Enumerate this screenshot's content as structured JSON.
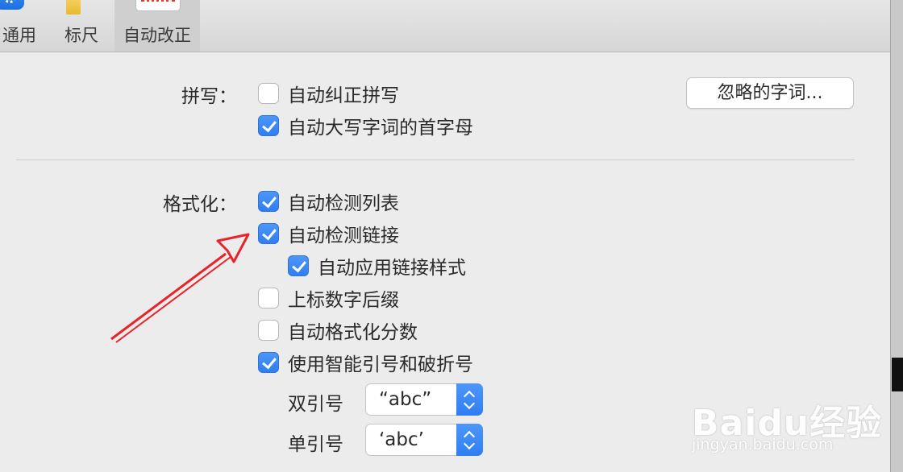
{
  "toolbar": {
    "items": [
      {
        "label": "通用",
        "icon": "gear-icon"
      },
      {
        "label": "标尺",
        "icon": "ruler-icon"
      },
      {
        "label": "自动改正",
        "icon": "autocorrect-icon"
      }
    ]
  },
  "spelling": {
    "label": "拼写：",
    "options": [
      {
        "label": "自动纠正拼写",
        "checked": false
      },
      {
        "label": "自动大写字词的首字母",
        "checked": true
      }
    ],
    "ignored_words_button": "忽略的字词..."
  },
  "formatting": {
    "label": "格式化：",
    "options": [
      {
        "label": "自动检测列表",
        "checked": true
      },
      {
        "label": "自动检测链接",
        "checked": true
      },
      {
        "label": "自动应用链接样式",
        "checked": true
      },
      {
        "label": "上标数字后缀",
        "checked": false
      },
      {
        "label": "自动格式化分数",
        "checked": false
      },
      {
        "label": "使用智能引号和破折号",
        "checked": true
      }
    ],
    "double_quotes": {
      "label": "双引号",
      "value": "“abc”"
    },
    "single_quotes": {
      "label": "单引号",
      "value": "‘abc’"
    }
  },
  "watermark": {
    "logo": "Baidu经验",
    "url": "jingyan.baidu.com"
  },
  "colors": {
    "accent": "#3b87f5",
    "arrow": "#e8232a",
    "window_bg": "#ececec"
  }
}
